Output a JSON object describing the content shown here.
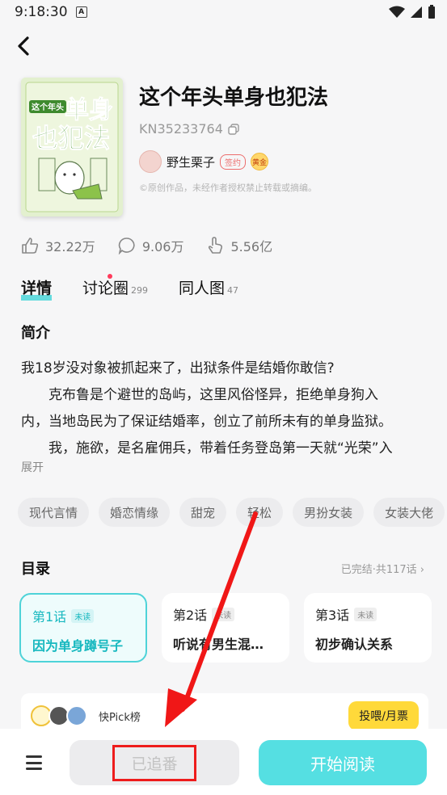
{
  "status_bar": {
    "time": "9:18:30",
    "notif_letter": "A"
  },
  "book": {
    "title": "这个年头单身也犯法",
    "id": "KN35233764",
    "author": "野生栗子",
    "sign_badge": "签约",
    "gold_badge": "黄金",
    "copyright": "©原创作品，未经作者授权禁止转载或摘编。",
    "cover_text": "这个年头单身也犯法"
  },
  "stats": {
    "likes": "32.22万",
    "comments": "9.06万",
    "views": "5.56亿"
  },
  "tabs": [
    {
      "label": "详情",
      "count": ""
    },
    {
      "label": "讨论圈",
      "count": "299"
    },
    {
      "label": "同人图",
      "count": "47"
    }
  ],
  "intro": {
    "heading": "简介",
    "lines": [
      "我18岁没对象被抓起来了，出狱条件是结婚你敢信?",
      "　　克布鲁是个避世的岛屿，这里风俗怪异，拒绝单身狗入",
      "内，当地岛民为了保证结婚率，创立了前所未有的单身监狱。",
      "　　我，施欲，是名雇佣兵，带着任务登岛第一天就“光荣”入"
    ],
    "expand_label": "展开"
  },
  "tags": [
    "现代言情",
    "婚恋情缘",
    "甜宠",
    "轻松",
    "男扮女装",
    "女装大佬"
  ],
  "toc": {
    "title": "目录",
    "status": "已完结·共117话 ›",
    "chapters": [
      {
        "num": "第1话",
        "unread": "未读",
        "name": "因为单身蹲号子"
      },
      {
        "num": "第2话",
        "unread": "未读",
        "name": "听说有男生混…"
      },
      {
        "num": "第3话",
        "unread": "未读",
        "name": "初步确认关系"
      }
    ]
  },
  "pick": {
    "label": "快Pick榜",
    "vote_label": "投喂/月票"
  },
  "bottom": {
    "follow_label": "已追番",
    "read_label": "开始阅读"
  },
  "colors": {
    "accent": "#55dfe2",
    "highlight": "#ee1c1c",
    "vote": "#ffd93a"
  }
}
